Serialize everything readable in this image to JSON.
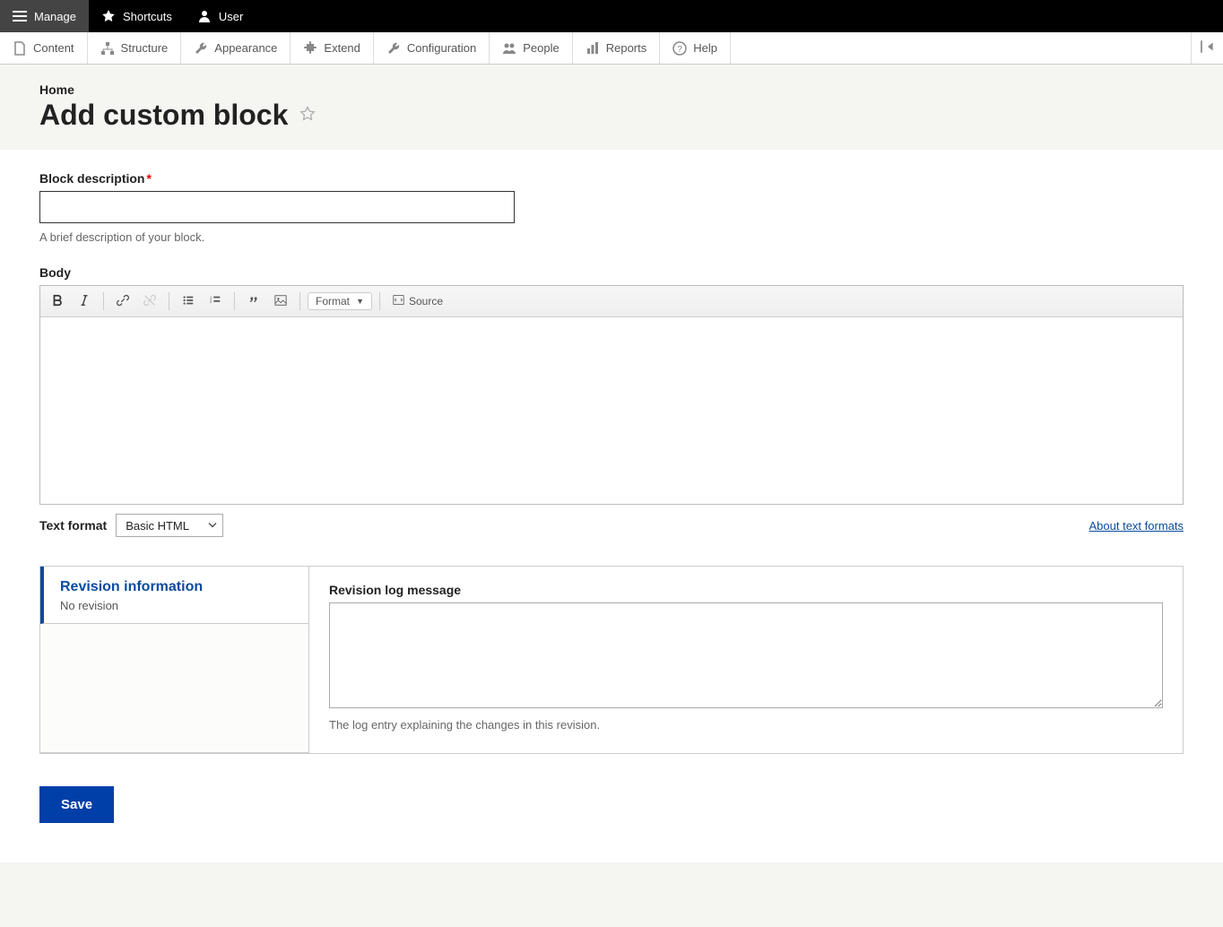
{
  "toolbar": {
    "manage": "Manage",
    "shortcuts": "Shortcuts",
    "user": "User"
  },
  "admin_menu": {
    "content": "Content",
    "structure": "Structure",
    "appearance": "Appearance",
    "extend": "Extend",
    "configuration": "Configuration",
    "people": "People",
    "reports": "Reports",
    "help": "Help"
  },
  "breadcrumb": "Home",
  "page_title": "Add custom block",
  "form": {
    "block_desc_label": "Block description",
    "block_desc_help": "A brief description of your block.",
    "block_desc_value": "",
    "body_label": "Body",
    "body_value": "",
    "format_dropdown_label": "Format",
    "source_label": "Source",
    "text_format_label": "Text format",
    "text_format_value": "Basic HTML",
    "about_formats": "About text formats"
  },
  "revision": {
    "tab_title": "Revision information",
    "tab_sub": "No revision",
    "log_label": "Revision log message",
    "log_value": "",
    "log_help": "The log entry explaining the changes in this revision."
  },
  "actions": {
    "save": "Save"
  }
}
